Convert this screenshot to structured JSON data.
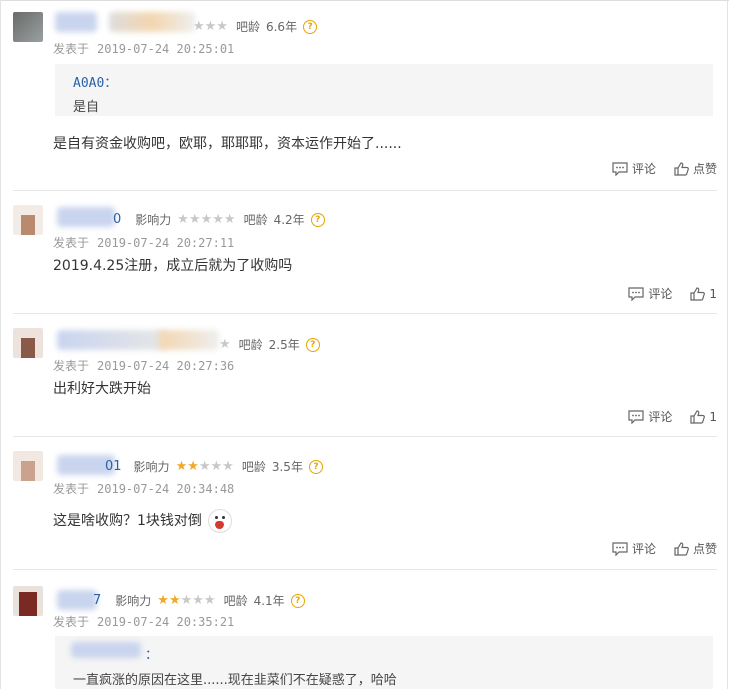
{
  "labels": {
    "influence": "影响力",
    "forum_age": "吧龄",
    "posted_at": "发表于",
    "comment": "评论",
    "like": "点赞"
  },
  "posts": [
    {
      "forum_age": "6.6年",
      "date": "2019-07-24 20:25:01",
      "quote": {
        "name": "A0A0：",
        "text": "是自"
      },
      "body": "是自有资金收购吧，欧耶，耶耶耶，资本运作开始了......",
      "like_label": "点赞"
    },
    {
      "name_tail": "0",
      "influence_stars": 0,
      "forum_age": "4.2年",
      "date": "2019-07-24 20:27:11",
      "body": "2019.4.25注册，成立后就为了收购吗",
      "like_label": "1"
    },
    {
      "forum_age": "2.5年",
      "date": "2019-07-24 20:27:36",
      "body": "出利好大跌开始",
      "like_label": "1"
    },
    {
      "name_tail": "01",
      "influence_stars": 2,
      "forum_age": "3.5年",
      "date": "2019-07-24 20:34:48",
      "body": "这是啥收购？1块钱对倒",
      "emoji": "crying-face-icon",
      "like_label": "点赞"
    },
    {
      "name_tail": "7",
      "influence_stars": 2,
      "forum_age": "4.1年",
      "date": "2019-07-24 20:35:21",
      "quote": {
        "name": "：",
        "text": "一直疯涨的原因在这里......现在韭菜们不在疑惑了，哈哈"
      }
    }
  ],
  "colors": {
    "star_on": "#f2a825",
    "star_off": "#c8c8c8",
    "link_blue": "#2b5fa8"
  }
}
